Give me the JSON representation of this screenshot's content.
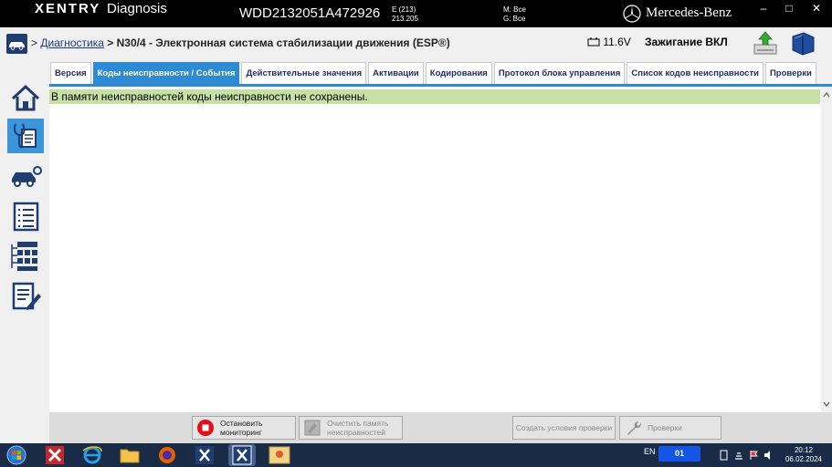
{
  "titlebar": {
    "brand": "XENTRY",
    "app": "Diagnosis",
    "vin": "WDD2132051A472926",
    "model_line1": "E (213)",
    "model_line2": "213.205",
    "m_label": "M: Все",
    "g_label": "G: Все",
    "maker": "Mercedes-Benz",
    "minimize": "–",
    "maximize": "□",
    "close": "✕"
  },
  "header": {
    "breadcrumb_sep": ">",
    "breadcrumb_link": "Диагностика",
    "breadcrumb_current": "> N30/4 - Электронная система стабилизации движения (ESP®)",
    "battery": "11.6V",
    "ignition": "Зажигание ВКЛ"
  },
  "tabs": [
    {
      "label": "Версия",
      "active": false
    },
    {
      "label": "Коды неисправности / События",
      "active": true
    },
    {
      "label": "Действительные значения",
      "active": false
    },
    {
      "label": "Активации",
      "active": false
    },
    {
      "label": "Кодирования",
      "active": false
    },
    {
      "label": "Протокол блока управления",
      "active": false
    },
    {
      "label": "Список кодов неисправности",
      "active": false
    },
    {
      "label": "Проверки",
      "active": false
    }
  ],
  "content": {
    "message": "В памяти неисправностей коды неисправности не сохранены."
  },
  "toolbar": {
    "stop_line1": "Остановить",
    "stop_line2": "мониторинг",
    "clear_line1": "Очистить память",
    "clear_line2": "неисправностей",
    "create_conditions": "Создать условия проверки",
    "checks": "Проверки"
  },
  "taskbar": {
    "lang": "EN",
    "badge": "01",
    "time": "20:12",
    "date": "06.02.2024"
  },
  "colors": {
    "accent": "#2e8ad2",
    "message_bg": "#c6e0a6",
    "stop_red": "#e0101a",
    "titlebar": "#000000"
  }
}
